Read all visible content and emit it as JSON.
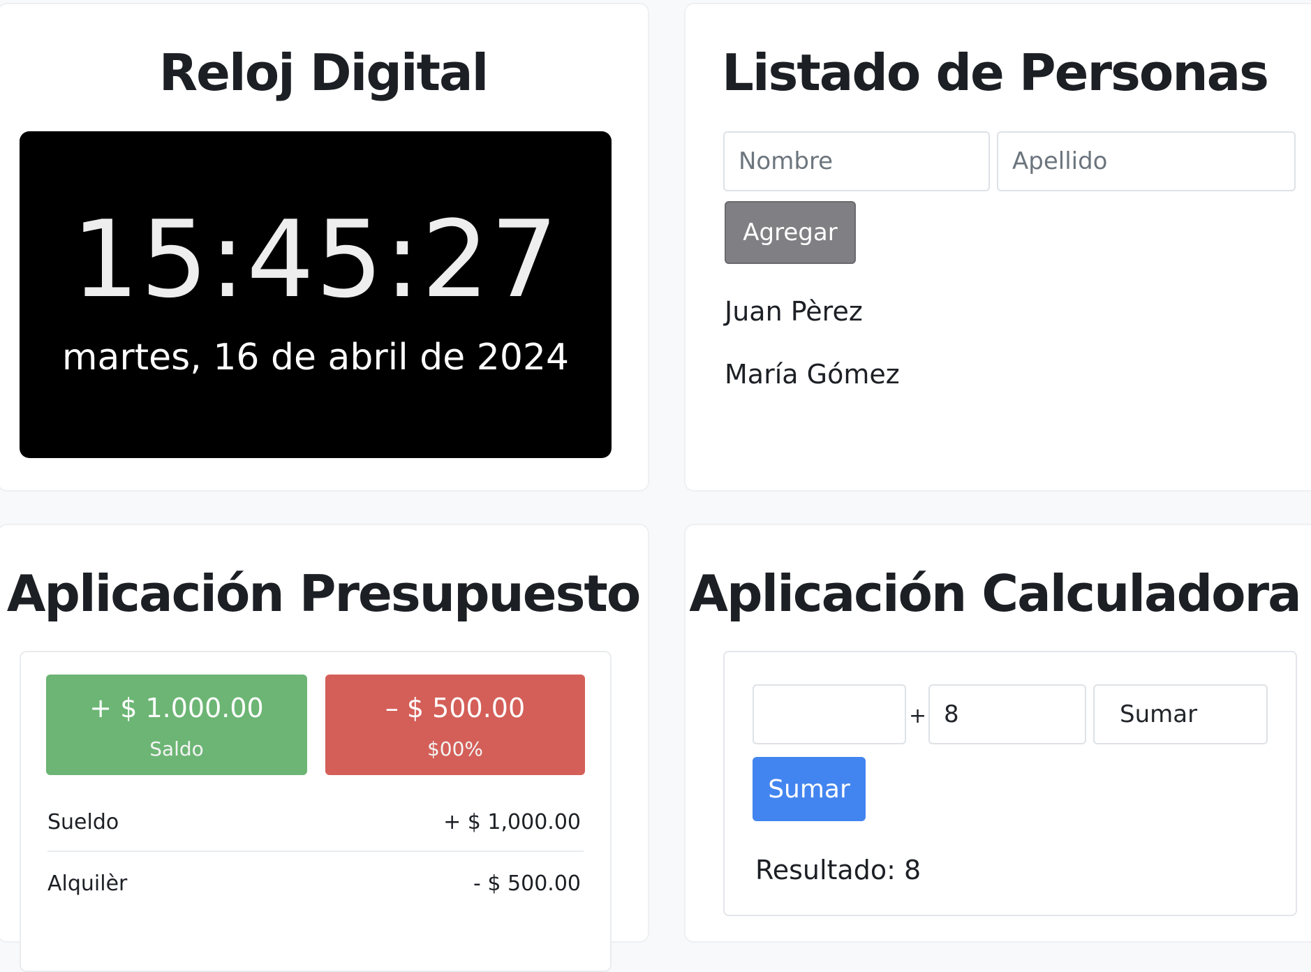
{
  "clock": {
    "title": "Reloj Digital",
    "time": "15:45:27",
    "date": "martes, 16 de abril de 2024"
  },
  "people": {
    "title": "Listado de Personas",
    "nombre_placeholder": "Nombre",
    "apellido_placeholder": "Apellido",
    "add_label": "Agregar",
    "list": [
      "Juan Pèrez",
      "María Gómez"
    ]
  },
  "budget": {
    "title": "Aplicación Presupuesto",
    "income": {
      "amount": "+ $ 1.000.00",
      "label": "Saldo"
    },
    "expense": {
      "amount": "– $ 500.00",
      "label": "$00%"
    },
    "items": [
      {
        "desc": "Sueldo",
        "value": "+ $ 1,000.00"
      },
      {
        "desc": "Alquilèr",
        "value": "- $ 500.00"
      }
    ],
    "colors": {
      "income": "#6cb574",
      "expense": "#d45f58"
    }
  },
  "calculator": {
    "title": "Aplicación Calculadora",
    "operand_a": "",
    "operator": "+",
    "operand_b": "8",
    "operation_selected": "Sumar",
    "button_label": "Sumar",
    "result": "Resultado: 8",
    "colors": {
      "button": "#4385f0"
    }
  }
}
